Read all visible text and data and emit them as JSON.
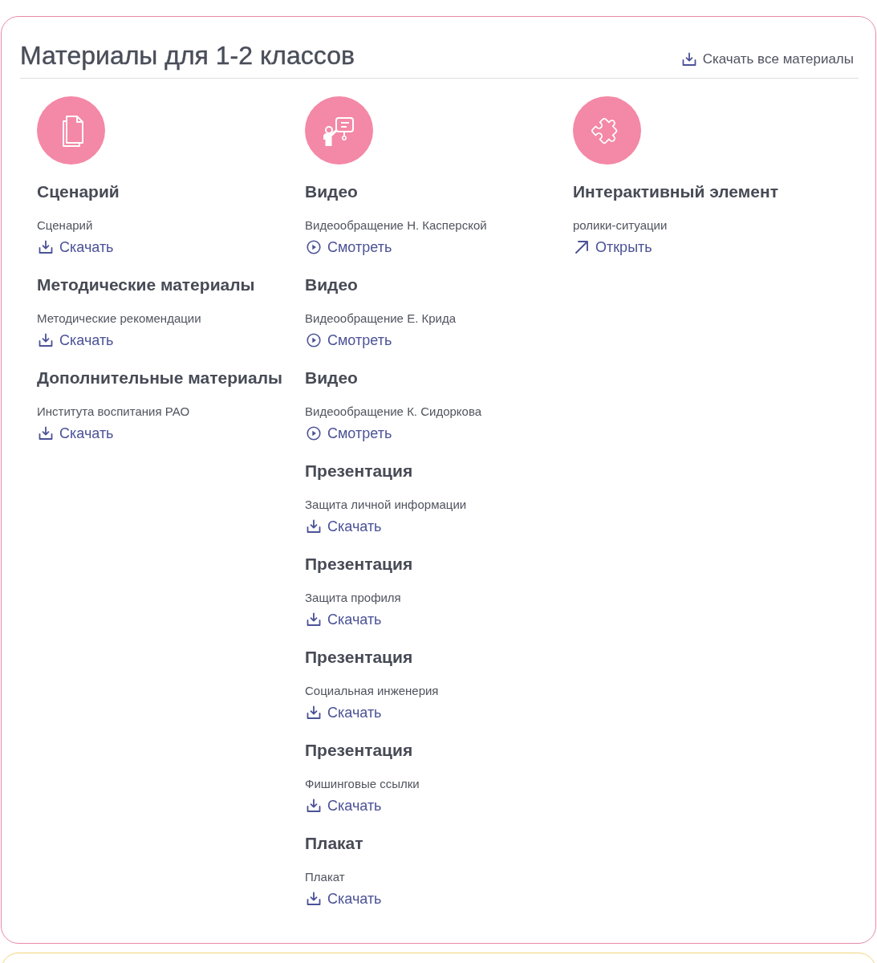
{
  "section": {
    "title": "Материалы для 1-2 классов",
    "download_all": {
      "kind": "download",
      "label": "Скачать все материалы"
    }
  },
  "columns": [
    {
      "kind": "documents",
      "items": [
        {
          "heading": "Сценарий",
          "name": "Сценарий",
          "action": {
            "kind": "download",
            "label": "Скачать"
          }
        },
        {
          "heading": "Методические материалы",
          "name": "Методические рекомендации",
          "action": {
            "kind": "download",
            "label": "Скачать"
          }
        },
        {
          "heading": "Дополнительные материалы",
          "name": "Института воспитания РАО",
          "action": {
            "kind": "download",
            "label": "Скачать"
          }
        }
      ]
    },
    {
      "kind": "video",
      "items": [
        {
          "heading": "Видео",
          "name": "Видеообращение Н. Касперской",
          "action": {
            "kind": "watch",
            "label": "Смотреть"
          }
        },
        {
          "heading": "Видео",
          "name": "Видеообращение Е. Крида",
          "action": {
            "kind": "watch",
            "label": "Смотреть"
          }
        },
        {
          "heading": "Видео",
          "name": "Видеообращение К. Сидоркова",
          "action": {
            "kind": "watch",
            "label": "Смотреть"
          }
        },
        {
          "heading": "Презентация",
          "name": "Защита личной информации",
          "action": {
            "kind": "download",
            "label": "Скачать"
          }
        },
        {
          "heading": "Презентация",
          "name": "Защита профиля",
          "action": {
            "kind": "download",
            "label": "Скачать"
          }
        },
        {
          "heading": "Презентация",
          "name": "Социальная инженерия",
          "action": {
            "kind": "download",
            "label": "Скачать"
          }
        },
        {
          "heading": "Презентация",
          "name": "Фишинговые ссылки",
          "action": {
            "kind": "download",
            "label": "Скачать"
          }
        },
        {
          "heading": "Плакат",
          "name": "Плакат",
          "action": {
            "kind": "download",
            "label": "Скачать"
          }
        }
      ]
    },
    {
      "kind": "interactive",
      "items": [
        {
          "heading": "Интерактивный элемент",
          "name": "ролики-ситуации",
          "action": {
            "kind": "open",
            "label": "Открыть"
          }
        }
      ]
    }
  ]
}
